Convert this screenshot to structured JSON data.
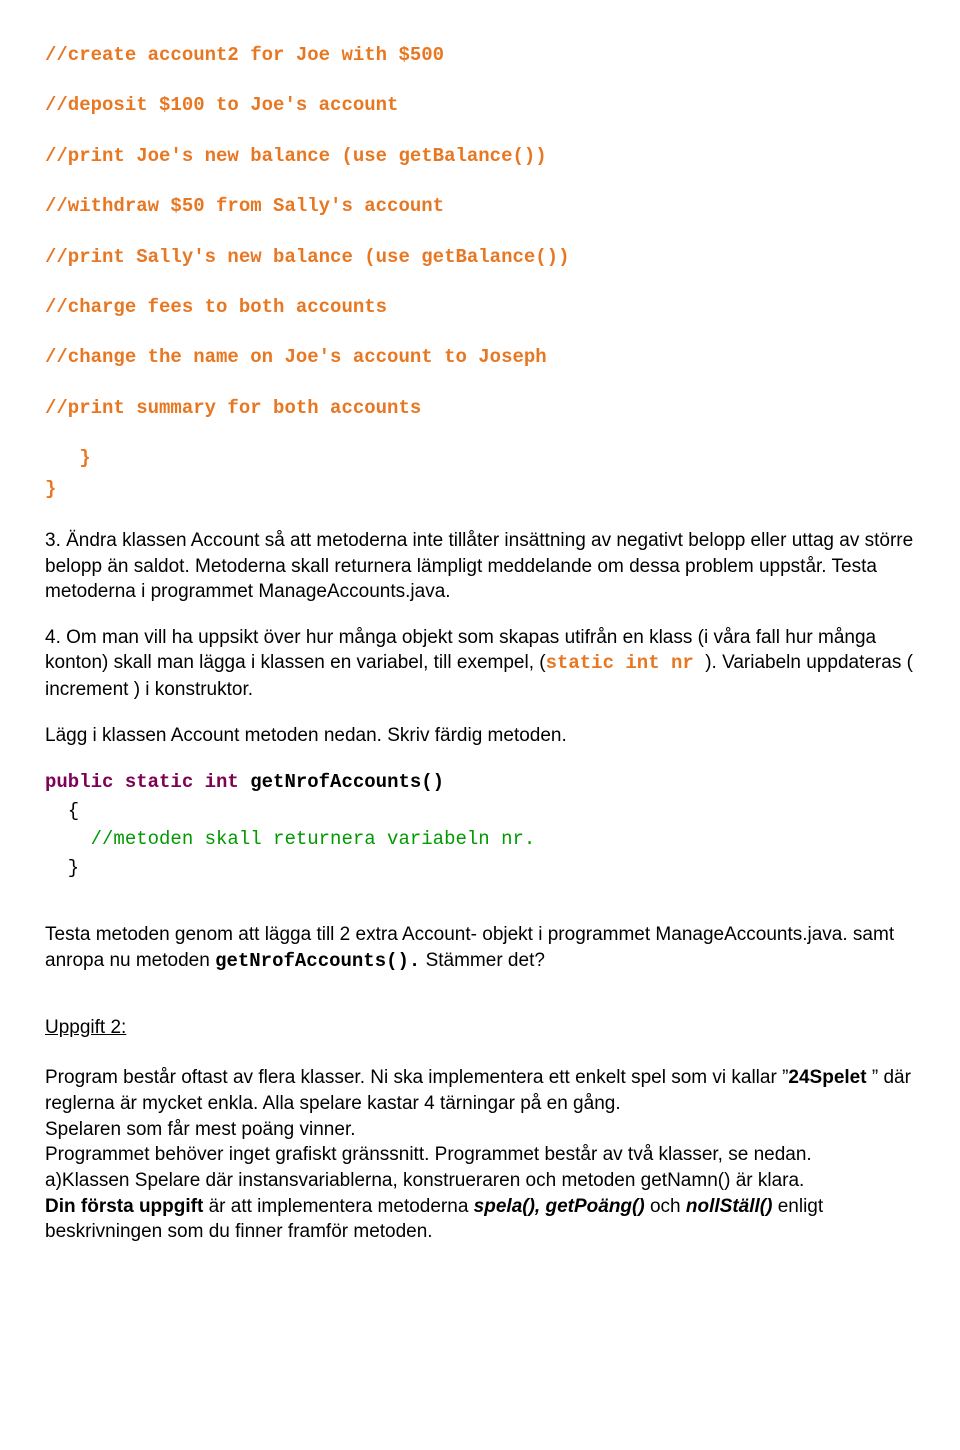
{
  "code1": {
    "l1": "//create account2 for Joe with $500",
    "l2": "//deposit $100 to Joe's account",
    "l3": "//print Joe's new balance (use getBalance())",
    "l4": "//withdraw $50 from Sally's account",
    "l5": "//print Sally's new balance (use getBalance())",
    "l6": "//charge fees to both accounts",
    "l7": "//change the name on Joe's account to Joseph",
    "l8": "//print summary for both accounts",
    "l9": "   }",
    "l10": "}"
  },
  "p3a": "3. Ändra klassen Account så att metoderna inte tillåter insättning av negativt belopp eller uttag av större belopp än saldot. Metoderna skall returnera lämpligt meddelande om dessa problem uppstår. Testa metoderna i programmet ManageAccounts.java.",
  "p4": {
    "a": "4. Om man vill ha uppsikt över hur många objekt som skapas utifrån en klass (i våra fall hur många konton) skall man lägga i klassen en variabel, till exempel, (",
    "code": "static int nr ",
    "b": "). Variabeln uppdateras ( increment ) i konstruktor."
  },
  "p5": "Lägg i klassen Account metoden nedan. Skriv färdig metoden.",
  "method": {
    "kw1": "public static int",
    "name": " getNrofAccounts()",
    "brace_open": "  {",
    "comment": "    //metoden skall returnera variabeln nr.",
    "brace_close": "  }"
  },
  "p6": {
    "a": "Testa metoden genom att lägga till 2 extra Account- objekt  i programmet ManageAccounts.java. samt anropa nu metoden ",
    "code": "getNrofAccounts().",
    "b": "  Stämmer det?"
  },
  "uppgift2": "Uppgift 2:",
  "p7": {
    "a": " Program består oftast av flera klasser. Ni ska implementera ett enkelt spel som vi kallar ",
    "q1": "”",
    "game": "24Spelet",
    "q2": " ”",
    "b": " där reglerna är mycket enkla.  Alla spelare kastar 4 tärningar på en gång."
  },
  "p8": "Spelaren som får mest poäng vinner.",
  "p9": "Programmet behöver inget grafiskt gränssnitt. Programmet består av två klasser, se nedan.",
  "p10": "a)Klassen Spelare där instansvariablerna, konstrueraren och metoden getNamn() är klara.",
  "p11": {
    "a": "Din första uppgift",
    "b": " är att implementera metoderna ",
    "c": "spela(), getPoäng() ",
    "d": "och",
    "e": " nollStäll()",
    "f": " enligt beskrivningen som du finner framför metoden."
  }
}
